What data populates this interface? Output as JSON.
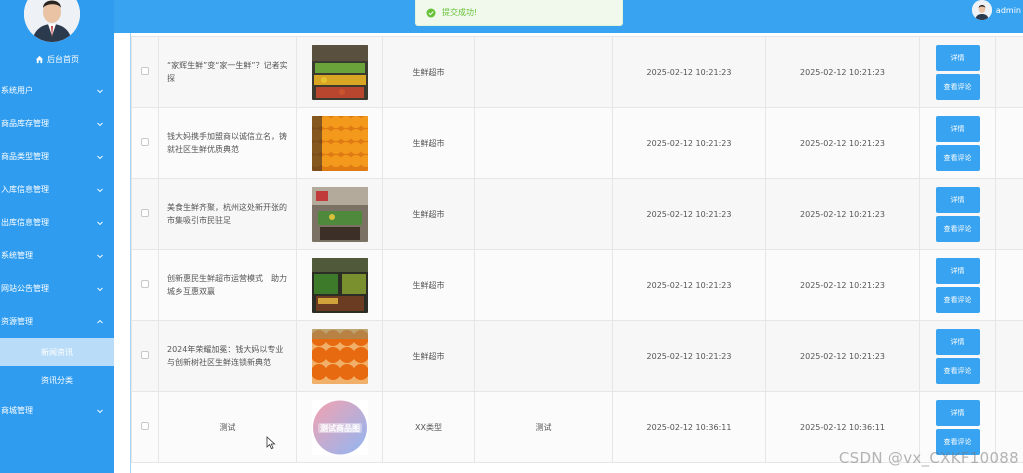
{
  "sidebar": {
    "home_label": "后台首页",
    "menu": [
      {
        "label": "系统用户"
      },
      {
        "label": "商品库存管理"
      },
      {
        "label": "商品类型管理"
      },
      {
        "label": "入库信息管理"
      },
      {
        "label": "出库信息管理"
      },
      {
        "label": "系统管理"
      },
      {
        "label": "网站公告管理"
      },
      {
        "label": "资源管理"
      }
    ],
    "submenu": [
      {
        "label": "新闻资讯"
      },
      {
        "label": "资讯分类"
      }
    ],
    "last_menu": {
      "label": "商城管理"
    }
  },
  "topbar": {
    "user_name": "admin"
  },
  "toast": {
    "message": "提交成功!"
  },
  "table": {
    "rows": [
      {
        "title": "“家辉生鲜”变“家一生鲜”？记者实探",
        "thumb": "market-produce",
        "category": "生鲜超市",
        "extra": "",
        "created": "2025-02-12 10:21:23",
        "updated": "2025-02-12 10:21:23",
        "detail": "详情",
        "review": "查看评论"
      },
      {
        "title": "钱大妈携手加盟商以诚信立名，铸就社区生鲜优质典范",
        "thumb": "oranges",
        "category": "生鲜超市",
        "extra": "",
        "created": "2025-02-12 10:21:23",
        "updated": "2025-02-12 10:21:23",
        "detail": "详情",
        "review": "查看评论"
      },
      {
        "title": "美食生鲜齐聚，杭州这处新开张的市集吸引市民驻足",
        "thumb": "market-stall",
        "category": "生鲜超市",
        "extra": "",
        "created": "2025-02-12 10:21:23",
        "updated": "2025-02-12 10:21:23",
        "detail": "详情",
        "review": "查看评论"
      },
      {
        "title": "创新惠民生鲜超市运营模式　助力城乡互惠双赢",
        "thumb": "supermarket",
        "category": "生鲜超市",
        "extra": "",
        "created": "2025-02-12 10:21:23",
        "updated": "2025-02-12 10:21:23",
        "detail": "详情",
        "review": "查看评论"
      },
      {
        "title": "2024年荣耀加冕：钱大妈以专业与创新树社区生鲜连锁新典范",
        "thumb": "citrus",
        "category": "生鲜超市",
        "extra": "",
        "created": "2025-02-12 10:21:23",
        "updated": "2025-02-12 10:21:23",
        "detail": "详情",
        "review": "查看评论"
      },
      {
        "title": "测试",
        "thumb": "test-image",
        "thumb_text": "测试商品图",
        "category": "XX类型",
        "extra": "测试",
        "created": "2025-02-12 10:36:11",
        "updated": "2025-02-12 10:36:11",
        "detail": "详情",
        "review": "查看评论"
      }
    ]
  },
  "watermark": "CSDN @vx_CXKF10088",
  "colors": {
    "sidebar": "#2f9cf0",
    "topbar": "#38a3f1",
    "button": "#38a3f1",
    "toast_bg": "#f0f9eb",
    "toast_text": "#67c23a"
  }
}
